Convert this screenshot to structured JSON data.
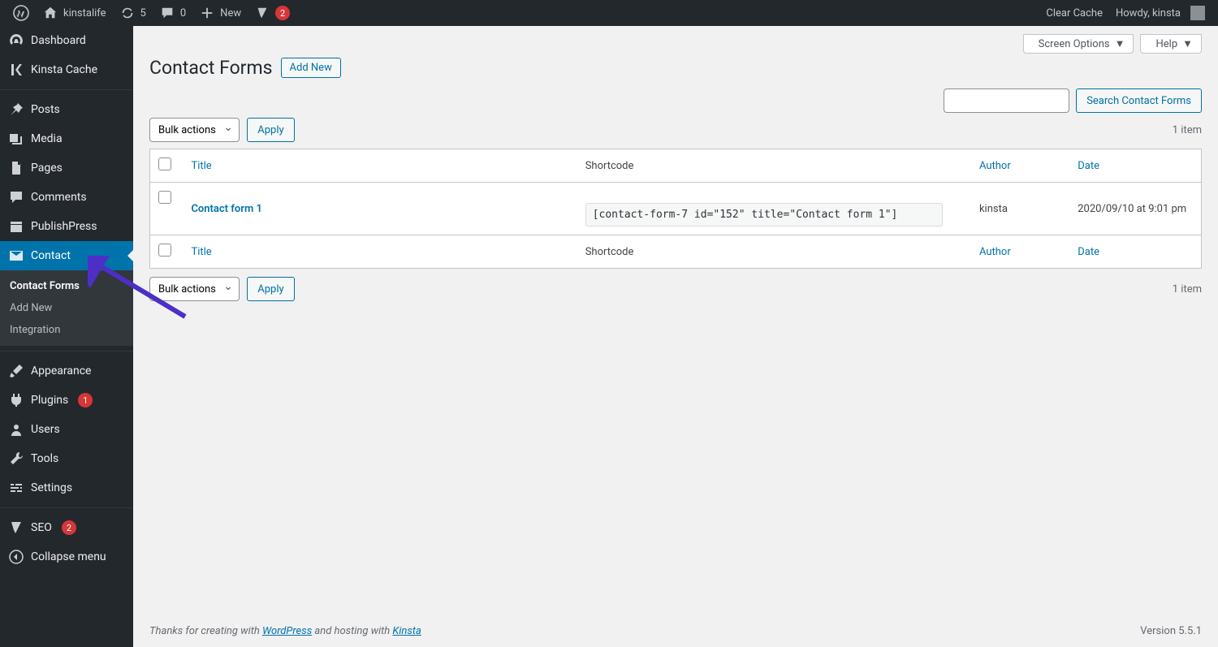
{
  "toolbar": {
    "site_name": "kinstalife",
    "updates": "5",
    "comments": "0",
    "new_label": "New",
    "yoast_badge": "2",
    "clear_cache": "Clear Cache",
    "howdy": "Howdy, kinsta"
  },
  "sidebar": {
    "dashboard": "Dashboard",
    "kinsta_cache": "Kinsta Cache",
    "posts": "Posts",
    "media": "Media",
    "pages": "Pages",
    "comments": "Comments",
    "publishpress": "PublishPress",
    "contact": "Contact",
    "sub_contact_forms": "Contact Forms",
    "sub_add_new": "Add New",
    "sub_integration": "Integration",
    "appearance": "Appearance",
    "plugins": "Plugins",
    "plugins_badge": "1",
    "users": "Users",
    "tools": "Tools",
    "settings": "Settings",
    "seo": "SEO",
    "seo_badge": "2",
    "collapse": "Collapse menu"
  },
  "screen": {
    "options": "Screen Options",
    "help": "Help"
  },
  "page": {
    "title": "Contact Forms",
    "add_new": "Add New",
    "search_btn": "Search Contact Forms"
  },
  "bulk": {
    "label": "Bulk actions",
    "apply": "Apply",
    "item_count": "1 item"
  },
  "cols": {
    "title": "Title",
    "shortcode": "Shortcode",
    "author": "Author",
    "date": "Date"
  },
  "rows": [
    {
      "title": "Contact form 1",
      "shortcode": "[contact-form-7 id=\"152\" title=\"Contact form 1\"]",
      "author": "kinsta",
      "date": "2020/09/10 at 9:01 pm"
    }
  ],
  "footer": {
    "pre": "Thanks for creating with ",
    "wp": "WordPress",
    "mid": " and hosting with ",
    "kinsta": "Kinsta",
    "version": "Version 5.5.1"
  }
}
